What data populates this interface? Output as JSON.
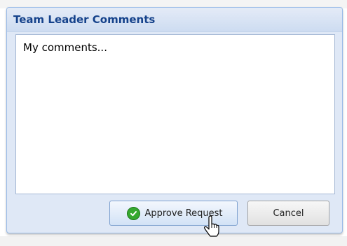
{
  "dialog": {
    "title": "Team Leader Comments"
  },
  "comments": {
    "value": "My comments..."
  },
  "buttons": {
    "approve_label": "Approve Request",
    "approve_icon": "check-circle-icon",
    "cancel_label": "Cancel"
  },
  "cursor": {
    "icon": "hand-pointer-icon"
  },
  "colors": {
    "title": "#15428b",
    "panel_background": "#dfe8f6",
    "panel_border": "#99bbe8",
    "approve_icon": "#35a82f"
  }
}
